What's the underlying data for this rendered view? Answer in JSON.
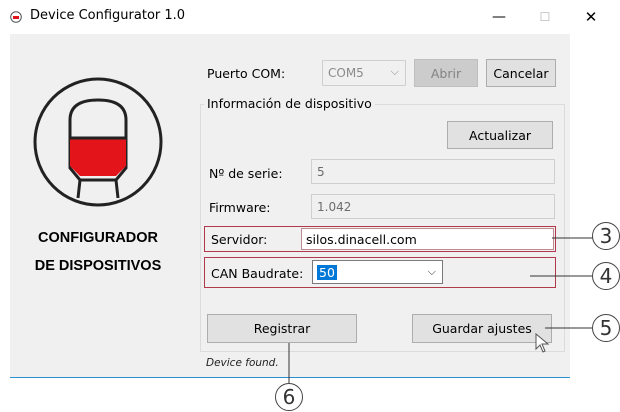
{
  "window": {
    "title": "Device Configurator 1.0",
    "minimize": "—",
    "maximize": "☐",
    "close": "✕"
  },
  "logo": {
    "line1": "CONFIGURADOR",
    "line2": "DE DISPOSITIVOS",
    "accent": "#e3151b"
  },
  "com": {
    "label": "Puerto COM:",
    "value": "COM5",
    "open_label": "Abrir",
    "cancel_label": "Cancelar"
  },
  "device_info": {
    "title": "Información de dispositivo",
    "refresh_label": "Actualizar",
    "serial_label": "Nº de serie:",
    "serial_value": "5",
    "firmware_label": "Firmware:",
    "firmware_value": "1.042"
  },
  "server": {
    "label": "Servidor:",
    "value": "silos.dinacell.com"
  },
  "can": {
    "label": "CAN Baudrate:",
    "value": "50"
  },
  "actions": {
    "register_label": "Registrar",
    "save_label": "Guardar ajustes"
  },
  "status": {
    "text": "Device found."
  },
  "callouts": [
    "3",
    "4",
    "5",
    "6"
  ]
}
